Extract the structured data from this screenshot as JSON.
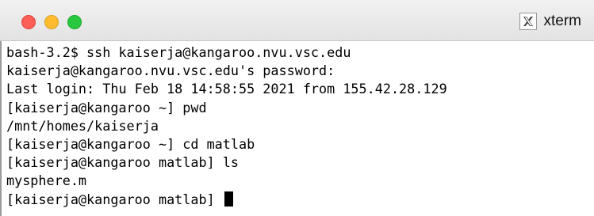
{
  "window": {
    "title": "xterm",
    "app_icon": "x11-icon",
    "traffic_lights": {
      "close_color": "#fd5f57",
      "minimize_color": "#febc2e",
      "zoom_color": "#28c840"
    }
  },
  "terminal": {
    "lines": [
      "bash-3.2$ ssh kaiserja@kangaroo.nvu.vsc.edu",
      "kaiserja@kangaroo.nvu.vsc.edu's password:",
      "Last login: Thu Feb 18 14:58:55 2021 from 155.42.28.129",
      "[kaiserja@kangaroo ~] pwd",
      "/mnt/homes/kaiserja",
      "[kaiserja@kangaroo ~] cd matlab",
      "[kaiserja@kangaroo matlab] ls",
      "mysphere.m"
    ],
    "prompt": "[kaiserja@kangaroo matlab] "
  }
}
